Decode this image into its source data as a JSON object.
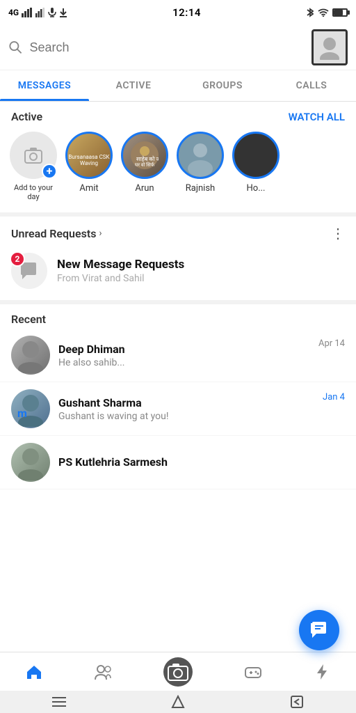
{
  "statusBar": {
    "signal": "4G",
    "time": "12:14",
    "icons": [
      "bluetooth",
      "wifi",
      "battery"
    ]
  },
  "search": {
    "placeholder": "Search"
  },
  "tabs": [
    {
      "label": "MESSAGES",
      "active": true
    },
    {
      "label": "ACTIVE",
      "active": false
    },
    {
      "label": "GROUPS",
      "active": false
    },
    {
      "label": "CALLS",
      "active": false
    }
  ],
  "activeSection": {
    "title": "Active",
    "watchAllLabel": "WATCH ALL"
  },
  "addDay": {
    "label": "Add to your day"
  },
  "activeUsers": [
    {
      "name": "Amit"
    },
    {
      "name": "Arun"
    },
    {
      "name": "Rajnish"
    },
    {
      "name": "Ho..."
    }
  ],
  "unreadRequests": {
    "title": "Unread Requests",
    "badgeCount": "2",
    "cardTitle": "New Message Requests",
    "cardSub": "From Virat and Sahil"
  },
  "recentSection": {
    "label": "Recent"
  },
  "chats": [
    {
      "name": "Deep Dhiman",
      "preview": "He also sahib...",
      "date": "Apr 14",
      "dateBlue": false
    },
    {
      "name": "Gushant Sharma",
      "preview": "Gushant is waving at you!",
      "date": "Jan 4",
      "dateBlue": true
    },
    {
      "name": "PS Kutlehria Sarmesh",
      "preview": "",
      "date": "...",
      "dateBlue": false
    }
  ],
  "bottomNav": [
    {
      "icon": "home",
      "label": "Home",
      "active": true
    },
    {
      "icon": "people",
      "label": "People",
      "active": false
    },
    {
      "icon": "camera",
      "label": "Camera",
      "active": false
    },
    {
      "icon": "games",
      "label": "Games",
      "active": false
    },
    {
      "icon": "flash",
      "label": "Flash",
      "active": false
    }
  ],
  "fab": {
    "icon": "message"
  }
}
